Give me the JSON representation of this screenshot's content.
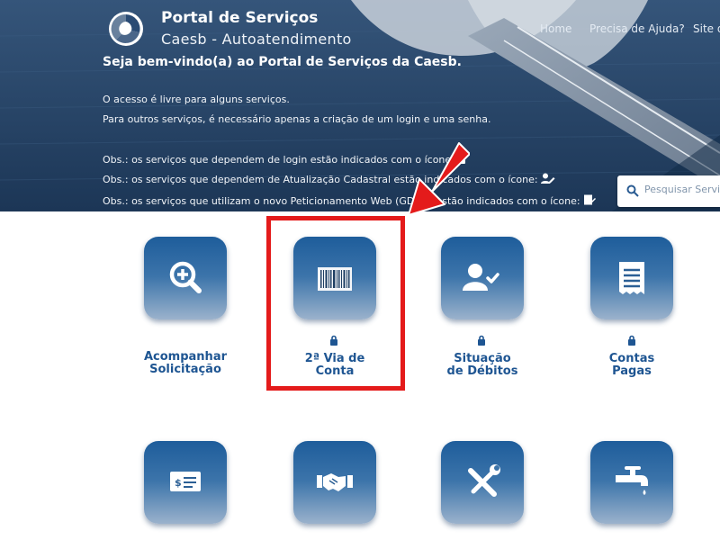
{
  "header": {
    "title": "Portal de Serviços",
    "subtitle": "Caesb - Autoatendimento",
    "nav": [
      "Home",
      "Precisa de Ajuda?",
      "Site da Caesb"
    ]
  },
  "intro": {
    "welcome": "Seja bem-vindo(a) ao Portal de Serviços da Caesb.",
    "line1": "O acesso é livre para alguns serviços.",
    "line2": "Para outros serviços, é necessário apenas a criação de um login e uma senha.",
    "obs1": "Obs.: os serviços que dependem de login estão indicados com o ícone:",
    "obs2": "Obs.: os serviços que dependem de Atualização Cadastral estão indicados com o ícone:",
    "obs3": "Obs.: os serviços que utilizam o novo Peticionamento Web (GDOC) estão indicados com o ícone:"
  },
  "search": {
    "placeholder": "Pesquisar Serviços"
  },
  "services": [
    {
      "line1": "Acompanhar",
      "line2": "Solicitação",
      "icon": "magnifier-plus-icon",
      "requires_login": false
    },
    {
      "line1": "2ª Via de",
      "line2": "Conta",
      "icon": "barcode-icon",
      "requires_login": true
    },
    {
      "line1": "Situação",
      "line2": "de Débitos",
      "icon": "user-check-icon",
      "requires_login": true
    },
    {
      "line1": "Contas",
      "line2": "Pagas",
      "icon": "receipt-icon",
      "requires_login": true
    },
    {
      "icon": "money-check-icon"
    },
    {
      "icon": "handshake-icon"
    },
    {
      "icon": "tools-icon"
    },
    {
      "icon": "faucet-icon"
    }
  ],
  "colors": {
    "label_blue": "#1e5592",
    "tile_top": "#1e5d9b",
    "tile_bottom": "#9bb2cc",
    "highlight_red": "#e41b1b"
  }
}
